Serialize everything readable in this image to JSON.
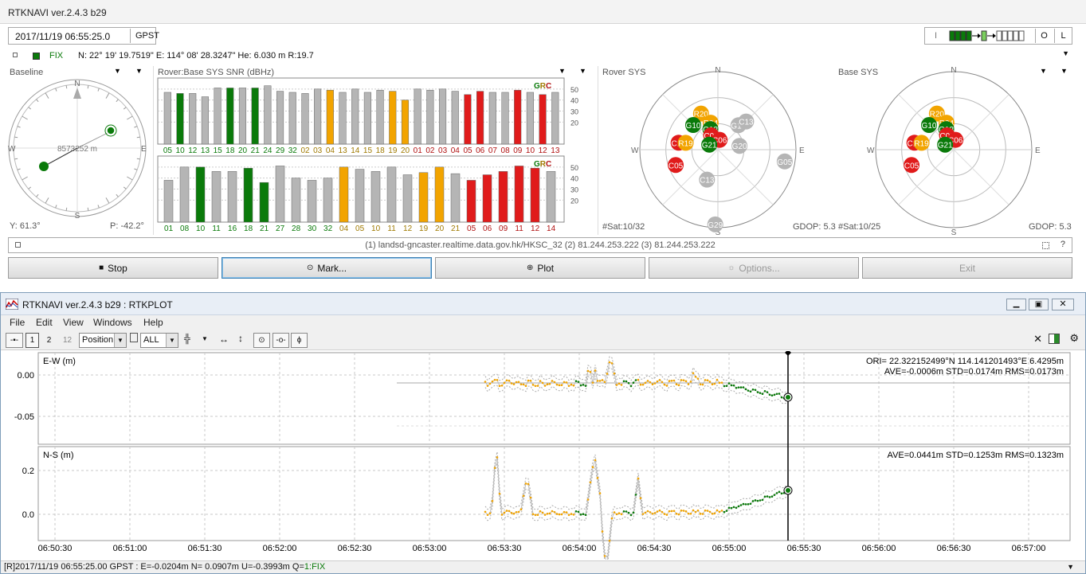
{
  "navi": {
    "title": "RTKNAVI ver.2.4.3 b29",
    "time": "2017/11/19 06:55:25.0",
    "timesys": "GPST",
    "btn_i": "I",
    "btn_o": "O",
    "btn_l": "L",
    "solution_status": "FIX",
    "solution_text": "N: 22° 19' 19.7519\" E: 114° 08' 28.3247\" He: 6.030 m R:19.7",
    "baseline_label": "Baseline",
    "baseline_dist": "8573252 m",
    "baseline_yaw": "Y: 61.3°",
    "baseline_pitch": "P: -42.2°",
    "compass": {
      "n": "N",
      "s": "S",
      "e": "E",
      "w": "W"
    },
    "snr_label": "Rover:Base SYS SNR (dBHz)",
    "snr_ticks": [
      "50",
      "40",
      "30",
      "20"
    ],
    "snr_legend": [
      "G",
      "R",
      "C"
    ],
    "rover_sys_label": "Rover SYS",
    "base_sys_label": "Base SYS",
    "rover_nsat": "#Sat:10/32",
    "rover_gdop": "GDOP: 5.3",
    "base_nsat": "#Sat:10/25",
    "base_gdop": "GDOP: 5.3",
    "stream_text": "(1) landsd-gncaster.realtime.data.gov.hk/HKSC_32 (2) 81.244.253.222 (3) 81.244.253.222",
    "stream_q": "?",
    "buttons": {
      "stop": "Stop",
      "mark": "Mark...",
      "plot": "Plot",
      "options": "Options...",
      "exit": "Exit"
    }
  },
  "snr_rover": {
    "labels": [
      "05",
      "10",
      "12",
      "13",
      "15",
      "18",
      "20",
      "21",
      "24",
      "29",
      "32",
      "02",
      "03",
      "04",
      "13",
      "14",
      "15",
      "18",
      "19",
      "20",
      "01",
      "02",
      "03",
      "04",
      "05",
      "06",
      "07",
      "08",
      "09",
      "10",
      "12",
      "13"
    ],
    "values": [
      47,
      46,
      46,
      43,
      51,
      51,
      51,
      51,
      53,
      48,
      47,
      46,
      50,
      49,
      47,
      50,
      47,
      49,
      48,
      40,
      50,
      49,
      50,
      48,
      45,
      48,
      47,
      47,
      49,
      47,
      45,
      47
    ],
    "colors": [
      "g",
      "G",
      "g",
      "g",
      "g",
      "G",
      "g",
      "G",
      "g",
      "g",
      "g",
      "g",
      "g",
      "Y",
      "g",
      "g",
      "g",
      "g",
      "Y",
      "Y",
      "g",
      "g",
      "g",
      "g",
      "R",
      "R",
      "g",
      "g",
      "R",
      "g",
      "R",
      "g"
    ],
    "label_colors": [
      "G",
      "G",
      "G",
      "G",
      "G",
      "G",
      "G",
      "G",
      "G",
      "G",
      "G",
      "Y",
      "Y",
      "Y",
      "Y",
      "Y",
      "Y",
      "Y",
      "Y",
      "Y",
      "R",
      "R",
      "R",
      "R",
      "R",
      "R",
      "R",
      "R",
      "R",
      "R",
      "R",
      "R"
    ]
  },
  "snr_base": {
    "labels": [
      "01",
      "08",
      "10",
      "11",
      "16",
      "18",
      "21",
      "27",
      "28",
      "30",
      "32",
      "04",
      "05",
      "10",
      "11",
      "12",
      "19",
      "20",
      "21",
      "05",
      "06",
      "09",
      "11",
      "12",
      "14"
    ],
    "values": [
      38,
      50,
      50,
      46,
      46,
      49,
      36,
      51,
      40,
      38,
      40,
      50,
      48,
      46,
      50,
      43,
      45,
      50,
      44,
      38,
      43,
      46,
      51,
      49,
      46
    ],
    "colors": [
      "g",
      "g",
      "G",
      "g",
      "g",
      "G",
      "G",
      "g",
      "g",
      "g",
      "g",
      "Y",
      "g",
      "g",
      "g",
      "g",
      "Y",
      "Y",
      "g",
      "R",
      "R",
      "R",
      "R",
      "R",
      "g"
    ],
    "label_colors": [
      "G",
      "G",
      "G",
      "G",
      "G",
      "G",
      "G",
      "G",
      "G",
      "G",
      "G",
      "Y",
      "Y",
      "Y",
      "Y",
      "Y",
      "Y",
      "Y",
      "Y",
      "R",
      "R",
      "R",
      "R",
      "R",
      "R"
    ]
  },
  "sky_rover": [
    {
      "id": "R20",
      "az": -25,
      "el": 50,
      "c": "Y"
    },
    {
      "id": "G10",
      "az": -45,
      "el": 55,
      "c": "G"
    },
    {
      "id": "R04",
      "az": -15,
      "el": 62,
      "c": "Y"
    },
    {
      "id": "G18",
      "az": -20,
      "el": 68,
      "c": "G"
    },
    {
      "id": "C09",
      "az": -25,
      "el": 74,
      "c": "R"
    },
    {
      "id": "C06",
      "az": 10,
      "el": 80,
      "c": "R"
    },
    {
      "id": "G15",
      "az": 40,
      "el": 58,
      "c": "g"
    },
    {
      "id": "C13",
      "az": 45,
      "el": 50,
      "c": "g"
    },
    {
      "id": "C12",
      "az": -80,
      "el": 50,
      "c": "R"
    },
    {
      "id": "R19",
      "az": -78,
      "el": 57,
      "c": "Y"
    },
    {
      "id": "G21",
      "az": -60,
      "el": 80,
      "c": "G"
    },
    {
      "id": "G20",
      "az": 80,
      "el": 68,
      "c": "g"
    },
    {
      "id": "C05",
      "az": -110,
      "el": 45,
      "c": "R"
    },
    {
      "id": "C13b",
      "az": -160,
      "el": 58,
      "c": "g"
    },
    {
      "id": "G05",
      "az": 100,
      "el": 22,
      "c": "g"
    },
    {
      "id": "G29",
      "az": -178,
      "el": 15,
      "c": "g"
    }
  ],
  "plot": {
    "title": "RTKNAVI ver.2.4.3 b29 : RTKPLOT",
    "menu": [
      "File",
      "Edit",
      "View",
      "Windows",
      "Help"
    ],
    "toolbar": {
      "b1": "1",
      "b2": "2",
      "b12": "12",
      "plot_type": "Position",
      "sat": "ALL"
    },
    "ew_label": "E-W (m)",
    "ns_label": "N-S (m)",
    "ori": "ORI= 22.322152499°N  114.141201493°E 6.4295m",
    "ew_stats": "AVE=-0.0006m STD=0.0174m RMS=0.0173m",
    "ns_stats": "AVE=0.0441m STD=0.1253m RMS=0.1323m",
    "ew_yticks": [
      "0.00",
      "-0.05"
    ],
    "ns_yticks": [
      "0.2",
      "0.0"
    ],
    "xticks": [
      "06:50:30",
      "06:51:00",
      "06:51:30",
      "06:52:00",
      "06:52:30",
      "06:53:00",
      "06:53:30",
      "06:54:00",
      "06:54:30",
      "06:55:00",
      "06:55:30",
      "06:56:00",
      "06:56:30",
      "06:57:00"
    ],
    "status": "[R]2017/11/19 06:55:25.00 GPST : E=-0.0204m N= 0.0907m U=-0.3993m Q=",
    "status_q": "1:FIX"
  },
  "colors": {
    "green": "#0a7a0a",
    "yellow": "#f2a400",
    "red": "#e01b1b",
    "gray": "#b5b5b5",
    "gpslabel": "#0a7a0a",
    "glolabel": "#a07a00",
    "bdslabel": "#b01010"
  }
}
